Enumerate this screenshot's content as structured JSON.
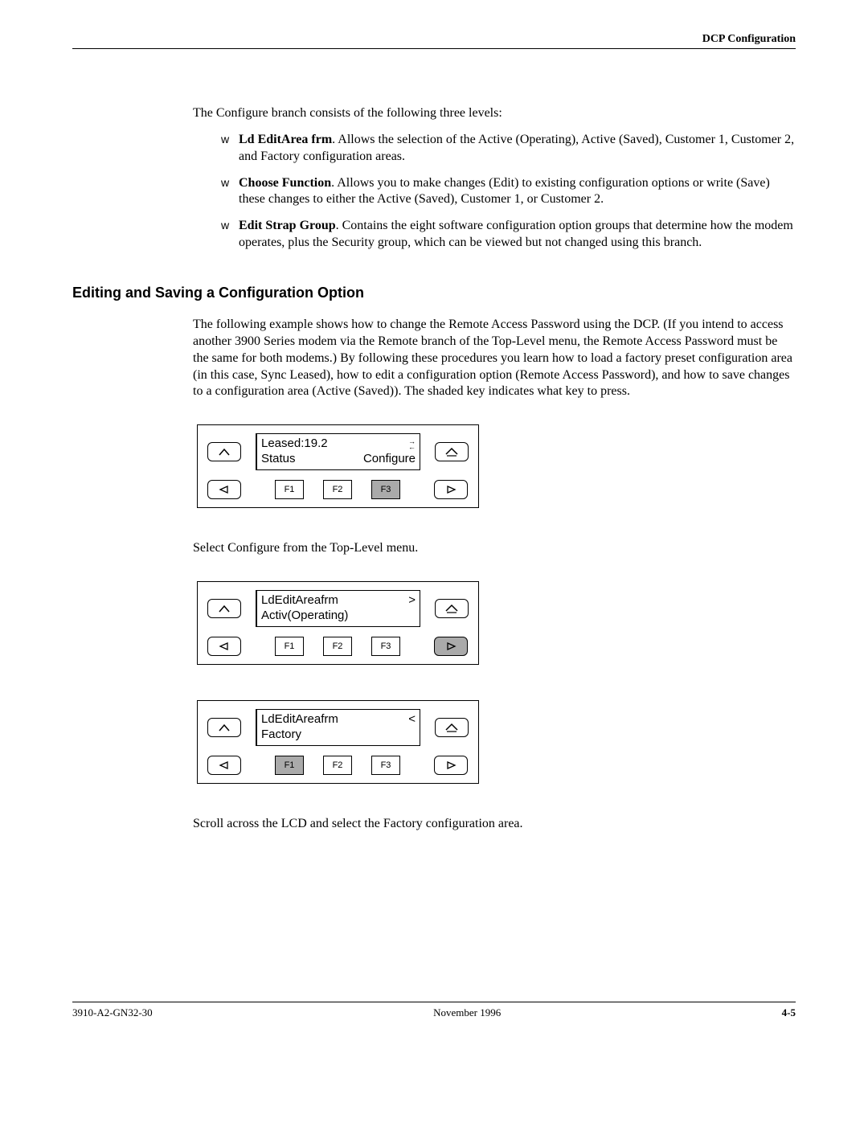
{
  "header": {
    "running_title": "DCP Configuration"
  },
  "intro": "The Configure branch consists of the following three levels:",
  "bullets": [
    {
      "title": "Ld EditArea frm",
      "text": ". Allows the selection of the Active (Operating), Active (Saved), Customer 1, Customer 2, and Factory configuration areas."
    },
    {
      "title": "Choose Function",
      "text": ". Allows you to make changes (Edit) to existing configuration options or write (Save) these changes to either the Active (Saved), Customer 1, or Customer 2."
    },
    {
      "title": "Edit Strap Group",
      "text": ". Contains the eight software configuration option groups that determine how the modem operates, plus the Security group, which can be viewed but not changed using this branch."
    }
  ],
  "section_heading": "Editing and Saving a Configuration Option",
  "section_para": "The following example shows how to change the Remote Access Password using the DCP. (If you intend to access another 3900 Series modem via the Remote branch of the Top-Level menu, the Remote Access Password must be the same for both modems.) By following these procedures you learn how to load a factory preset configuration area (in this case, Sync Leased), how to edit a configuration option (Remote Access Password), and how to save changes to a configuration area (Active (Saved)). The shaded key indicates what key to press.",
  "lcd": [
    {
      "line1_left": "Leased:19.2",
      "line1_right_glyph": "arrows",
      "line2_left": "Status",
      "line2_right": "Configure",
      "shaded_key": "F3"
    },
    {
      "line1_left": "LdEditAreafrm",
      "line1_right": ">",
      "line2_left": "Activ(Operating)",
      "line2_right": "",
      "shaded_key": ""
    },
    {
      "line1_left": "LdEditAreafrm",
      "line1_right": "<",
      "line2_left": "Factory",
      "line2_right": "",
      "shaded_key": "F1"
    }
  ],
  "step1_text": "Select Configure from the Top-Level menu.",
  "step2_text": "Scroll across the LCD and select the Factory configuration area.",
  "fkeys": {
    "f1": "F1",
    "f2": "F2",
    "f3": "F3"
  },
  "bullet_glyph": "w",
  "footer": {
    "left": "3910-A2-GN32-30",
    "center": "November 1996",
    "right": "4-5"
  }
}
